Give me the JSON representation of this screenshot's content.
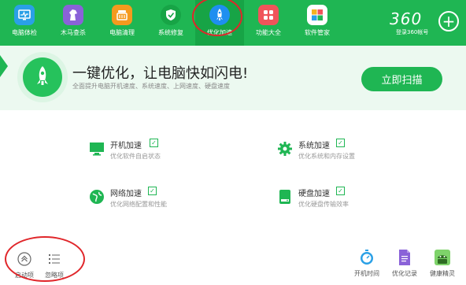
{
  "nav": {
    "items": [
      {
        "label": "电脑体检",
        "icon": "monitor-check-icon"
      },
      {
        "label": "木马查杀",
        "icon": "horse-icon"
      },
      {
        "label": "电脑清理",
        "icon": "broom-icon"
      },
      {
        "label": "系统修复",
        "icon": "shield-icon"
      },
      {
        "label": "优化加速",
        "icon": "rocket-icon"
      },
      {
        "label": "功能大全",
        "icon": "grid-icon"
      },
      {
        "label": "软件管家",
        "icon": "app-store-icon"
      }
    ],
    "active_index": 4,
    "logo": "360",
    "login_label": "登录360帐号"
  },
  "banner": {
    "title": "一键优化，让电脑快如闪电!",
    "subtitle": "全面提升电脑开机速度、系统速度、上网速度、硬盘速度",
    "scan_button": "立即扫描"
  },
  "features": [
    {
      "title": "开机加速",
      "desc": "优化软件自启状态",
      "icon": "monitor-icon",
      "checked": true
    },
    {
      "title": "系统加速",
      "desc": "优化系统和内存设置",
      "icon": "gear-icon",
      "checked": true
    },
    {
      "title": "网络加速",
      "desc": "优化网络配置和性能",
      "icon": "globe-icon",
      "checked": true
    },
    {
      "title": "硬盘加速",
      "desc": "优化硬盘传输效率",
      "icon": "hard-disk-icon",
      "checked": true
    }
  ],
  "bottom_left": [
    {
      "label": "启动项",
      "icon": "startup-icon"
    },
    {
      "label": "忽略项",
      "icon": "list-icon"
    }
  ],
  "bottom_right": [
    {
      "label": "开机时间",
      "icon": "stopwatch-icon"
    },
    {
      "label": "优化记录",
      "icon": "document-icon"
    },
    {
      "label": "健康精灵",
      "icon": "android-robot-icon"
    }
  ],
  "colors": {
    "brand": "#1fb653",
    "highlight_ring": "#e0262a",
    "active_tab": "#1e8ff0"
  }
}
